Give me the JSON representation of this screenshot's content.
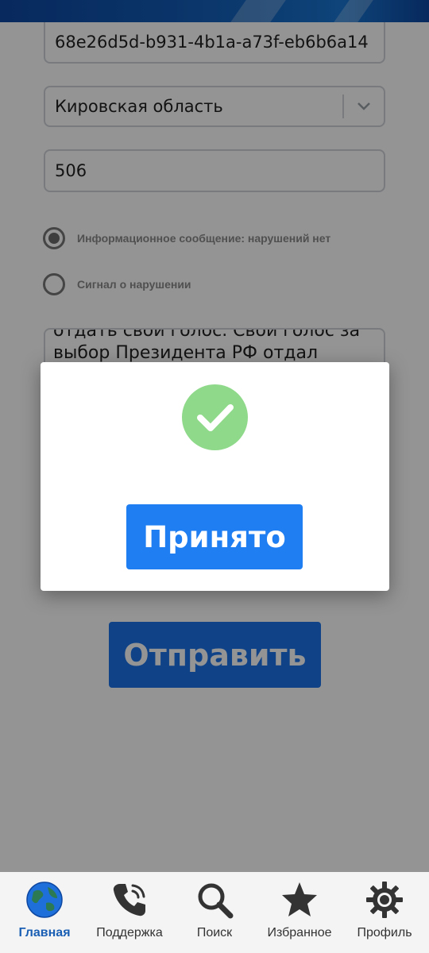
{
  "form": {
    "id_value": "68e26d5d-b931-4b1a-a73f-eb6b6a14",
    "region_value": "Кировская область",
    "number_value": "506",
    "radio_options": [
      {
        "label": "Информационное сообщение: нарушений нет",
        "selected": true
      },
      {
        "label": "Сигнал о нарушении",
        "selected": false
      }
    ],
    "message_lines": [
      "отдать свой голос. Свой голос за",
      "выбор Президента РФ отдал"
    ],
    "submit_label": "Отправить"
  },
  "modal": {
    "icon": "check-circle-icon",
    "accept_label": "Принято"
  },
  "nav": {
    "items": [
      {
        "label": "Главная",
        "icon": "globe-icon",
        "active": true
      },
      {
        "label": "Поддержка",
        "icon": "phone-icon",
        "active": false
      },
      {
        "label": "Поиск",
        "icon": "search-icon",
        "active": false
      },
      {
        "label": "Избранное",
        "icon": "star-icon",
        "active": false
      },
      {
        "label": "Профиль",
        "icon": "gear-icon",
        "active": false
      }
    ]
  },
  "colors": {
    "primary": "#1a73e8",
    "success": "#8fd98a",
    "nav_active": "#1a5fb4"
  }
}
